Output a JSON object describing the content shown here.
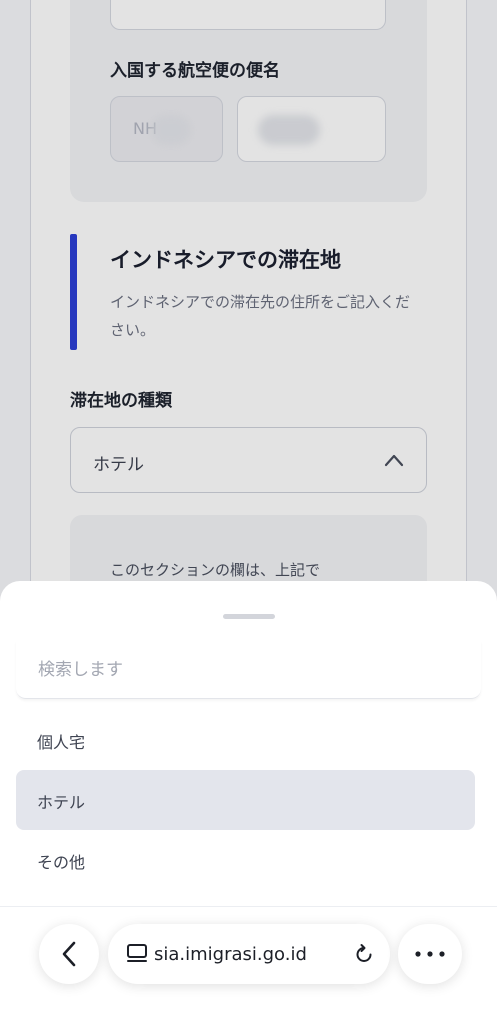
{
  "form": {
    "flight_label": "入国する航空便の便名",
    "flight_prefix": "NH",
    "stay_section_title": "インドネシアでの滞在地",
    "stay_section_desc": "インドネシアでの滞在先の住所をご記入ください。",
    "stay_type_label": "滞在地の種類",
    "stay_type_value": "ホテル",
    "info_text": "このセクションの欄は、上記で"
  },
  "sheet": {
    "search_placeholder": "検索します",
    "options": [
      "個人宅",
      "ホテル",
      "その他"
    ],
    "selected_index": 1
  },
  "browser": {
    "url": "sia.imigrasi.go.id"
  },
  "colors": {
    "accent": "#2c3fd6",
    "selected_option_bg": "#e3e5ec",
    "overlay": "rgba(0,0,0,0.11)"
  },
  "icons": [
    "chevron-up-icon",
    "back-chevron-icon",
    "tab-icon",
    "reload-icon",
    "more-icon"
  ]
}
